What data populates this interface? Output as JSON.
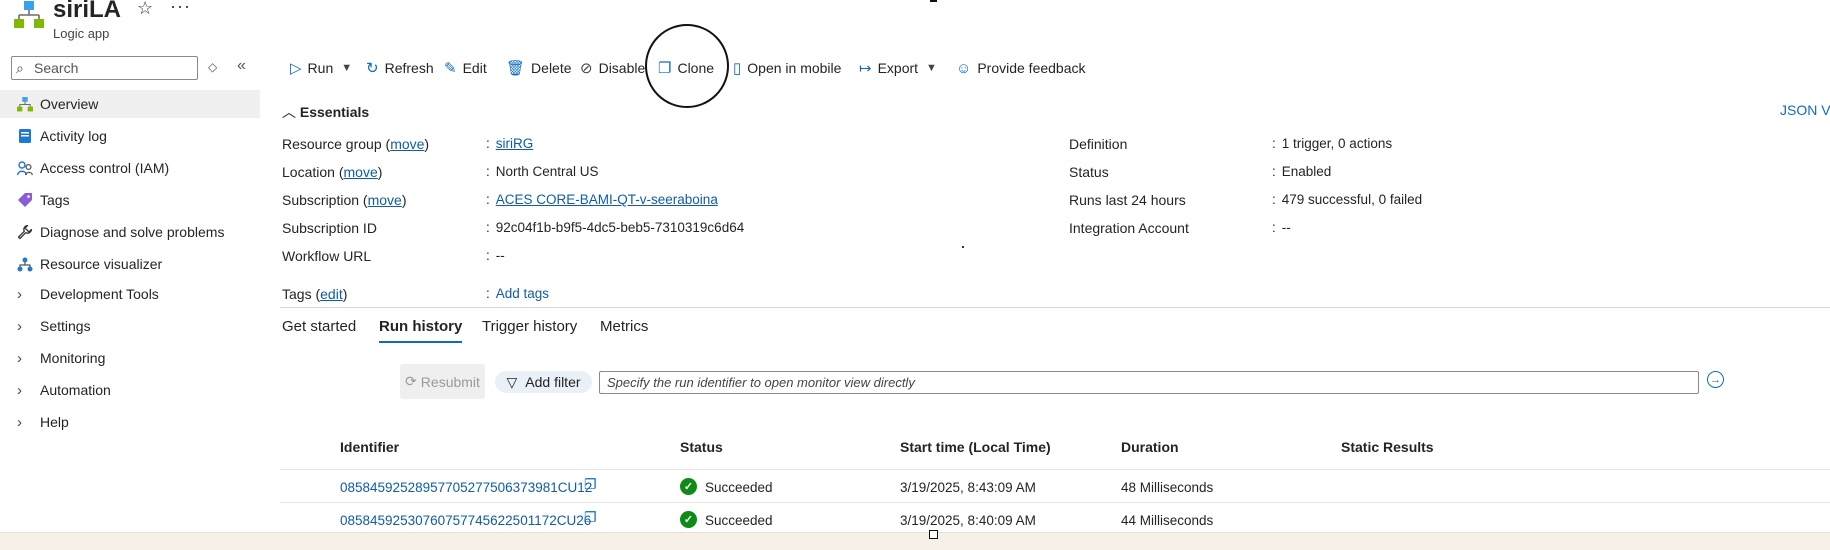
{
  "header": {
    "title": "siriLA",
    "subtitle": "Logic app",
    "star_glyph": "☆",
    "more_glyph": "···"
  },
  "sidebar": {
    "search_placeholder": "Search",
    "items": [
      {
        "label": "Overview",
        "icon": "logic-app-icon",
        "active": true
      },
      {
        "label": "Activity log",
        "icon": "log-icon"
      },
      {
        "label": "Access control (IAM)",
        "icon": "people-icon"
      },
      {
        "label": "Tags",
        "icon": "tag-icon"
      },
      {
        "label": "Diagnose and solve problems",
        "icon": "wrench-icon"
      },
      {
        "label": "Resource visualizer",
        "icon": "hierarchy-icon"
      },
      {
        "label": "Development Tools",
        "icon": "chevron-right-icon"
      },
      {
        "label": "Settings",
        "icon": "chevron-right-icon"
      },
      {
        "label": "Monitoring",
        "icon": "chevron-right-icon"
      },
      {
        "label": "Automation",
        "icon": "chevron-right-icon"
      },
      {
        "label": "Help",
        "icon": "chevron-right-icon"
      }
    ]
  },
  "toolbar": {
    "run": "Run",
    "refresh": "Refresh",
    "edit": "Edit",
    "delete": "Delete",
    "disable": "Disable",
    "clone": "Clone",
    "open_in_mobile": "Open in mobile",
    "export": "Export",
    "feedback": "Provide feedback"
  },
  "essentials": {
    "heading": "Essentials",
    "json_view": "JSON View",
    "left": {
      "resource_group_label": "Resource group",
      "resource_group_move": "move",
      "resource_group_value": "siriRG",
      "location_label": "Location",
      "location_move": "move",
      "location_value": "North Central US",
      "subscription_label": "Subscription",
      "subscription_move": "move",
      "subscription_value": "ACES CORE-BAMI-QT-v-seeraboina",
      "subscription_id_label": "Subscription ID",
      "subscription_id_value": "92c04f1b-b9f5-4dc5-beb5-7310319c6d64",
      "workflow_url_label": "Workflow URL",
      "workflow_url_value": "--",
      "tags_label": "Tags",
      "tags_edit": "edit",
      "tags_value": "Add tags"
    },
    "right": {
      "definition_label": "Definition",
      "definition_value": "1 trigger, 0 actions",
      "status_label": "Status",
      "status_value": "Enabled",
      "runs_label": "Runs last 24 hours",
      "runs_value": "479 successful, 0 failed",
      "integration_label": "Integration Account",
      "integration_value": "--"
    }
  },
  "tabs": [
    "Get started",
    "Run history",
    "Trigger history",
    "Metrics"
  ],
  "filter": {
    "resubmit": "Resubmit",
    "add_filter": "Add filter",
    "run_id_placeholder": "Specify the run identifier to open monitor view directly"
  },
  "table": {
    "columns": [
      "Identifier",
      "Status",
      "Start time (Local Time)",
      "Duration",
      "Static Results"
    ],
    "rows": [
      {
        "id": "08584592528957705277506373981CU12",
        "status": "Succeeded",
        "start": "3/19/2025, 8:43:09 AM",
        "duration": "48 Milliseconds"
      },
      {
        "id": "08584592530760757745622501172CU26",
        "status": "Succeeded",
        "start": "3/19/2025, 8:40:09 AM",
        "duration": "44 Milliseconds"
      }
    ]
  },
  "colors": {
    "accent": "#0f6cbd",
    "success": "#0e8a16"
  }
}
